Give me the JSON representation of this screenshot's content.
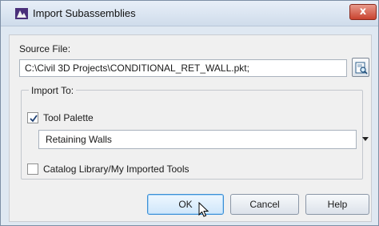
{
  "window": {
    "title": "Import Subassemblies",
    "close_label": "x"
  },
  "source": {
    "label": "Source File:",
    "value": "C:\\Civil 3D Projects\\CONDITIONAL_RET_WALL.pkt;"
  },
  "import_to": {
    "label": "Import To:",
    "tool_palette": {
      "label": "Tool Palette",
      "checked": true
    },
    "palette_select": {
      "selected": "Retaining Walls"
    },
    "catalog": {
      "label": "Catalog Library/My Imported Tools",
      "checked": false
    }
  },
  "buttons": {
    "ok": "OK",
    "cancel": "Cancel",
    "help": "Help"
  },
  "icons": {
    "app": "autocad-civil-icon",
    "browse": "browse-file-icon",
    "checkmark": "checkmark-icon",
    "dropdown": "chevron-down-icon",
    "cursor": "mouse-pointer-icon"
  },
  "colors": {
    "title_bg": "#cfdceb",
    "close": "#c9432f",
    "default_button_border": "#3c8fd6"
  }
}
